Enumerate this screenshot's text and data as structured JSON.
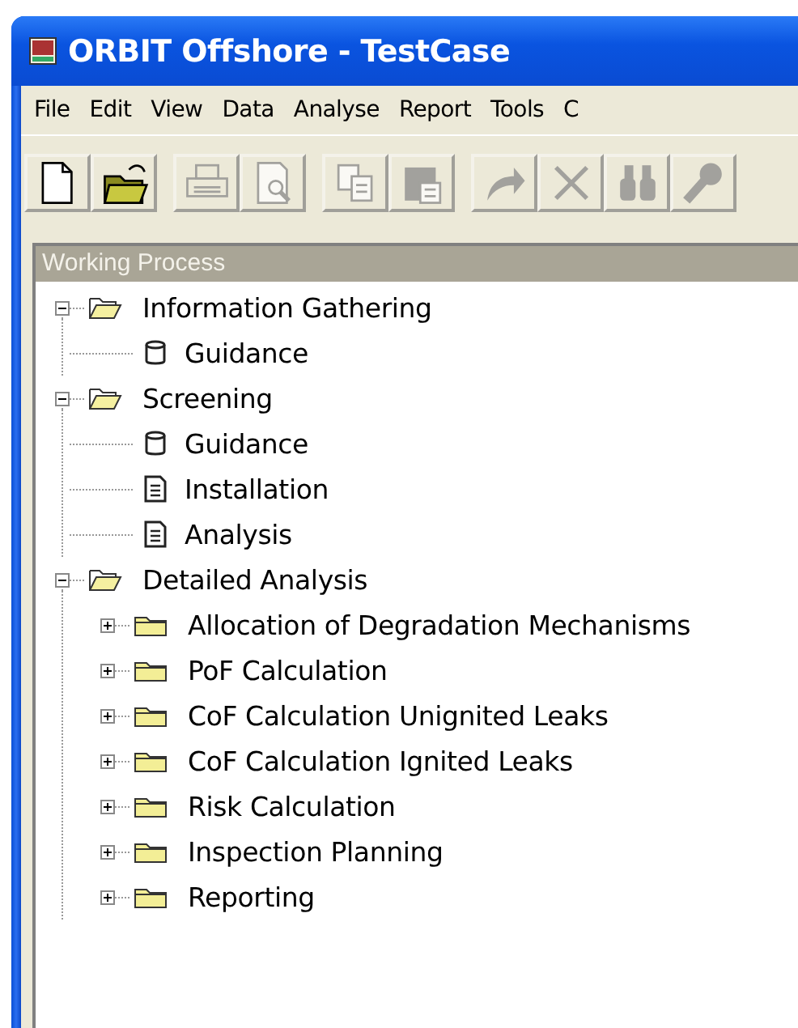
{
  "window": {
    "title": "ORBIT Offshore - TestCase"
  },
  "menu": [
    "File",
    "Edit",
    "View",
    "Data",
    "Analyse",
    "Report",
    "Tools",
    "C"
  ],
  "toolbar": [
    {
      "kind": "new",
      "disabled": false
    },
    {
      "kind": "open",
      "disabled": false
    },
    {
      "kind": "print",
      "disabled": true
    },
    {
      "kind": "preview",
      "disabled": true
    },
    {
      "kind": "copy",
      "disabled": true
    },
    {
      "kind": "paste",
      "disabled": true
    },
    {
      "kind": "redo",
      "disabled": true
    },
    {
      "kind": "delete",
      "disabled": true
    },
    {
      "kind": "find",
      "disabled": true
    },
    {
      "kind": "key",
      "disabled": true
    }
  ],
  "panel": {
    "title": "Working Process",
    "tree": [
      {
        "kind": "folder",
        "label": "Information Gathering",
        "expanded": true,
        "children": [
          {
            "kind": "guidance",
            "label": "Guidance"
          }
        ]
      },
      {
        "kind": "folder",
        "label": "Screening",
        "expanded": true,
        "children": [
          {
            "kind": "guidance",
            "label": "Guidance"
          },
          {
            "kind": "document",
            "label": "Installation"
          },
          {
            "kind": "document",
            "label": "Analysis"
          }
        ]
      },
      {
        "kind": "folder",
        "label": "Detailed Analysis",
        "expanded": true,
        "children": [
          {
            "kind": "folder",
            "label": "Allocation of Degradation Mechanisms",
            "expanded": false
          },
          {
            "kind": "folder",
            "label": "PoF Calculation",
            "expanded": false
          },
          {
            "kind": "folder",
            "label": "CoF Calculation Unignited Leaks",
            "expanded": false
          },
          {
            "kind": "folder",
            "label": "CoF Calculation Ignited Leaks",
            "expanded": false
          },
          {
            "kind": "folder",
            "label": "Risk Calculation",
            "expanded": false
          },
          {
            "kind": "folder",
            "label": "Inspection Planning",
            "expanded": false
          },
          {
            "kind": "folder",
            "label": "Reporting",
            "expanded": false
          }
        ]
      }
    ]
  }
}
